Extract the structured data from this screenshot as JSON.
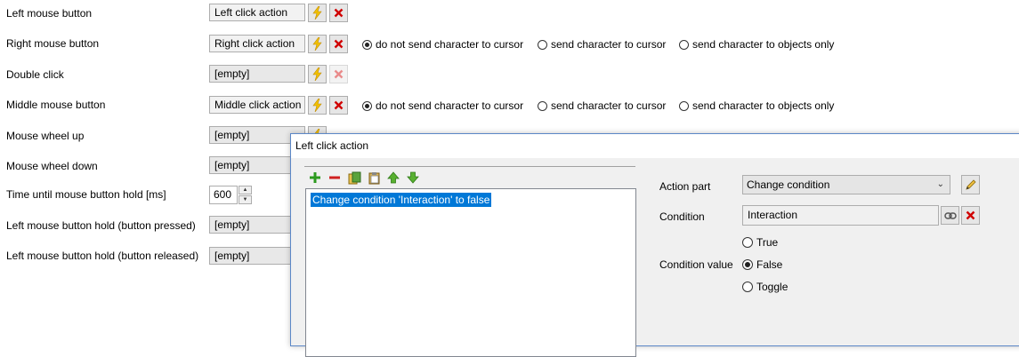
{
  "rows": [
    {
      "label": "Left mouse button",
      "action": "Left click action"
    },
    {
      "label": "Right mouse button",
      "action": "Right click action"
    },
    {
      "label": "Double click",
      "action": "[empty]"
    },
    {
      "label": "Middle mouse button",
      "action": "Middle click action"
    },
    {
      "label": "Mouse wheel up",
      "action": "[empty]"
    },
    {
      "label": "Mouse wheel down",
      "action": "[empty]"
    },
    {
      "label": "Time until mouse button hold [ms]",
      "value": "600"
    },
    {
      "label": "Left mouse button hold (button pressed)",
      "action": "[empty]"
    },
    {
      "label": "Left mouse button hold (button released)",
      "action": "[empty]"
    }
  ],
  "cursor_options": {
    "do_not_send": "do not send character to cursor",
    "send_cursor": "send character to cursor",
    "send_objects": "send character to objects only"
  },
  "dialog": {
    "title": "Left click action",
    "list_items": [
      "Change condition 'Interaction' to false"
    ],
    "action_part_label": "Action part",
    "action_part_value": "Change condition",
    "condition_label": "Condition",
    "condition_value": "Interaction",
    "condition_value_label": "Condition value",
    "options": [
      "True",
      "False",
      "Toggle"
    ],
    "selected_option": "False"
  },
  "colors": {
    "selection": "#0078d7",
    "delete_red": "#d00000",
    "lightning": "#f2c200"
  }
}
